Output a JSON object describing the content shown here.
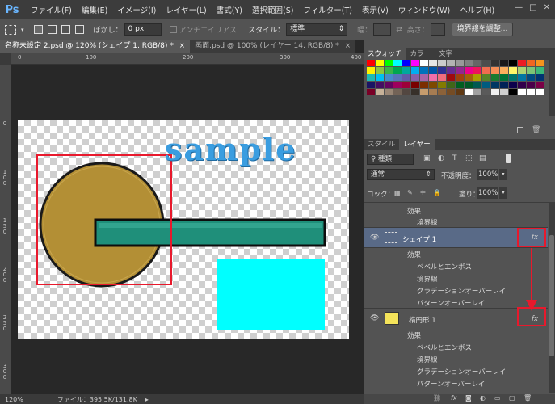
{
  "app": {
    "logo": "Ps"
  },
  "menu": [
    "ファイル(F)",
    "編集(E)",
    "イメージ(I)",
    "レイヤー(L)",
    "書式(Y)",
    "選択範囲(S)",
    "フィルター(T)",
    "表示(V)",
    "ウィンドウ(W)",
    "ヘルプ(H)"
  ],
  "window_controls": {
    "minimize": "—",
    "restore": "□",
    "close": "✕"
  },
  "options": {
    "feather_label": "ぼかし：",
    "feather_value": "0 px",
    "antialias_label": "アンチエイリアス",
    "style_label": "スタイル：",
    "style_value": "標準",
    "width_label": "幅：",
    "height_label": "高さ：",
    "refine_button": "境界線を調整..."
  },
  "doc_tabs": [
    {
      "label": "名称未設定 2.psd @ 120% (シェイプ 1, RGB/8) *",
      "close": "×"
    },
    {
      "label": "画面.psd @ 100% (レイヤー 14, RGB/8) *",
      "close": "×"
    }
  ],
  "ruler_top": [
    "0",
    "100",
    "200",
    "300",
    "400"
  ],
  "ruler_left": [
    "0",
    "1 0 0",
    "1 5 0",
    "2 0 0",
    "2 5 0",
    "3 0 0"
  ],
  "canvas_text": "sample",
  "status": {
    "zoom": "120%",
    "file_info": "ファイル：395.5K/131.8K"
  },
  "panels": {
    "swatch_tabs": [
      "スウォッチ",
      "カラー",
      "文字"
    ],
    "layer_tabs": [
      "スタイル",
      "レイヤー"
    ],
    "kind_label": "種類",
    "blend_mode": "通常",
    "opacity_label": "不透明度：",
    "opacity_value": "100%",
    "lock_label": "ロック：",
    "fill_label": "塗り：",
    "fill_value": "100%"
  },
  "layers_top": {
    "effects": "効果",
    "stroke": "境界線"
  },
  "layer_shape": {
    "name": "シェイプ 1",
    "fx": "fx",
    "effects": "効果",
    "items": [
      "ベベルとエンボス",
      "境界線",
      "グラデーションオーバーレイ",
      "パターンオーバーレイ"
    ]
  },
  "layer_ellipse": {
    "name": "楕円形 1",
    "fx": "fx",
    "effects": "効果",
    "items": [
      "ベベルとエンボス",
      "境界線",
      "グラデーションオーバーレイ",
      "パターンオーバーレイ"
    ]
  },
  "colors": {
    "selection_red": "#e8192c",
    "sample_blue": "#3a9de0",
    "circle_gold": "#b38f35",
    "bar_teal": "#1f8f7a",
    "rect_cyan": "#00ffff",
    "layer_selected": "#596a87"
  },
  "swatch_colors": [
    "#ff0000",
    "#ffff00",
    "#00ff00",
    "#00ffff",
    "#0000ff",
    "#ff00ff",
    "#ffffff",
    "#e6e6e6",
    "#cccccc",
    "#b3b3b3",
    "#999999",
    "#808080",
    "#666666",
    "#4d4d4d",
    "#333333",
    "#1a1a1a",
    "#000000",
    "#ee1c24",
    "#f26522",
    "#f7941d",
    "#fff200",
    "#8dc63f",
    "#39b54a",
    "#00a651",
    "#00a99d",
    "#00aeef",
    "#0072bc",
    "#0054a6",
    "#2e3192",
    "#662d91",
    "#92278f",
    "#ec008c",
    "#ed145b",
    "#f26c4f",
    "#f68e56",
    "#fbaf5d",
    "#fff568",
    "#acd373",
    "#7cc576",
    "#3cb878",
    "#1cbbb4",
    "#00bff3",
    "#448ccb",
    "#5674b9",
    "#605ca8",
    "#8560a8",
    "#a864a8",
    "#f06eaa",
    "#f26d7d",
    "#9e0b0f",
    "#a0410d",
    "#a36209",
    "#aba000",
    "#598527",
    "#197b30",
    "#007236",
    "#00746b",
    "#0076a3",
    "#004b80",
    "#003471",
    "#1b1464",
    "#440e62",
    "#630460",
    "#9e005d",
    "#9e0039",
    "#790000",
    "#7b2e00",
    "#7d4900",
    "#827b00",
    "#406618",
    "#005e20",
    "#005826",
    "#005952",
    "#005b7f",
    "#003663",
    "#002157",
    "#0d004c",
    "#32004b",
    "#4b0049",
    "#7b0046",
    "#7a0026",
    "#c7b299",
    "#998675",
    "#736357",
    "#534741",
    "#37302a",
    "#c69c6d",
    "#a67c52",
    "#8c6239",
    "#754c24",
    "#603913",
    "#ffffff",
    "#a0a0a0",
    "#5a5a5a",
    "#f0f0f0",
    "#d0d0d0",
    "#000000",
    "#ffffff",
    "#ffffff",
    "#ffffff"
  ]
}
